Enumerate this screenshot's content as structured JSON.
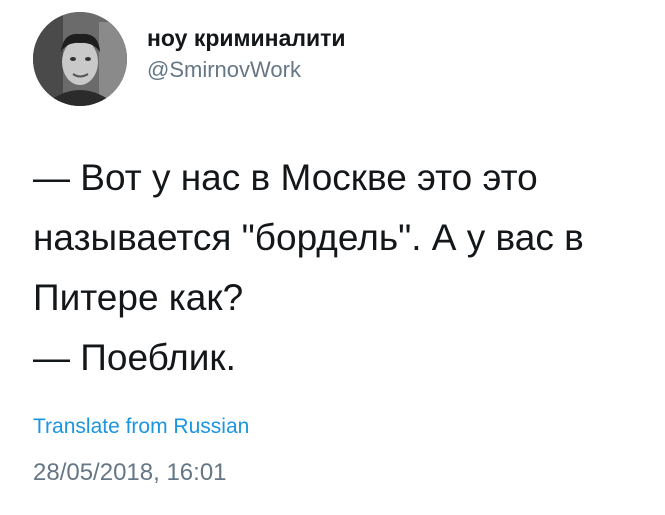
{
  "tweet": {
    "author": {
      "display_name": "ноу криминалити",
      "handle": "@SmirnovWork"
    },
    "text_lines": [
      "— Вот у нас в Москве это это называется \"бордель\". А у вас в Питере как?",
      "— Поеблик."
    ],
    "translate_label": "Translate from Russian",
    "timestamp": "28/05/2018, 16:01"
  },
  "colors": {
    "text": "#14171a",
    "secondary": "#657786",
    "link": "#1b95e0",
    "background": "#ffffff"
  }
}
